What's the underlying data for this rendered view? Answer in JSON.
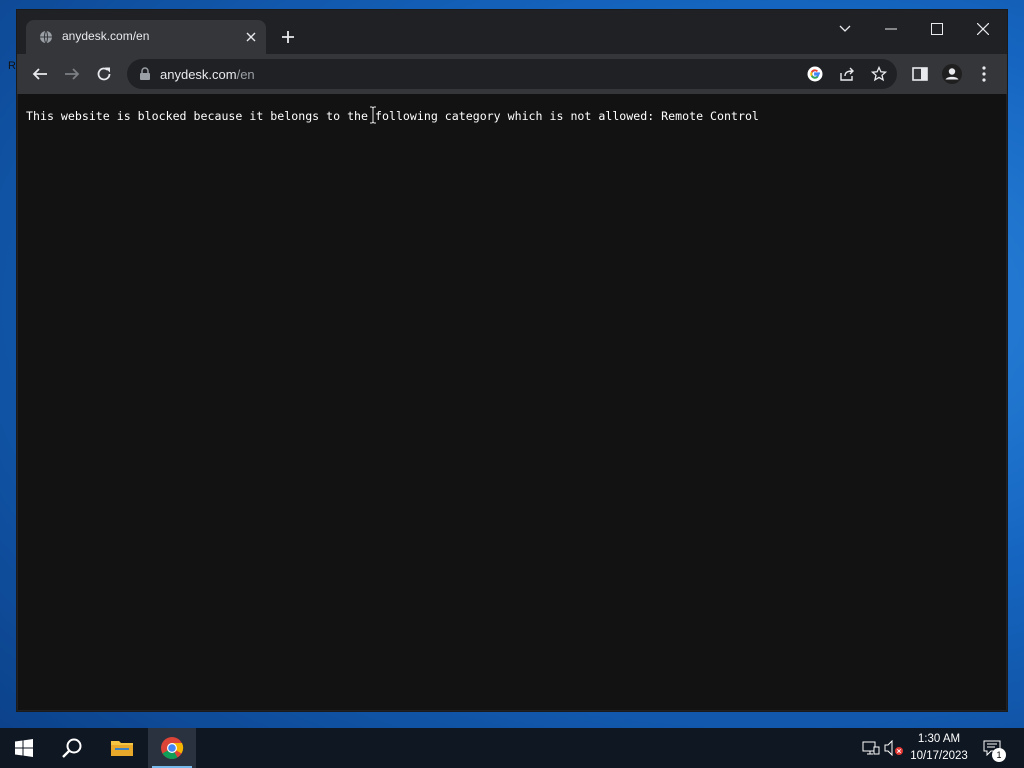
{
  "desktop": {
    "left_label": "R"
  },
  "browser": {
    "tab": {
      "title": "anydesk.com/en",
      "favicon": "globe-icon"
    },
    "toolbar": {
      "url_host": "anydesk.com",
      "url_path": "/en"
    },
    "page": {
      "message": "This website is blocked because it belongs to the following category which is not allowed: Remote Control"
    }
  },
  "taskbar": {
    "apps": [
      "start",
      "search",
      "file-explorer",
      "chrome"
    ],
    "clock": {
      "time": "1:30 AM",
      "date": "10/17/2023"
    },
    "notification_count": "1"
  },
  "colors": {
    "titlebar": "#202124",
    "toolbar": "#35363a",
    "page_background": "#121212",
    "taskbar": "#0f1722"
  }
}
